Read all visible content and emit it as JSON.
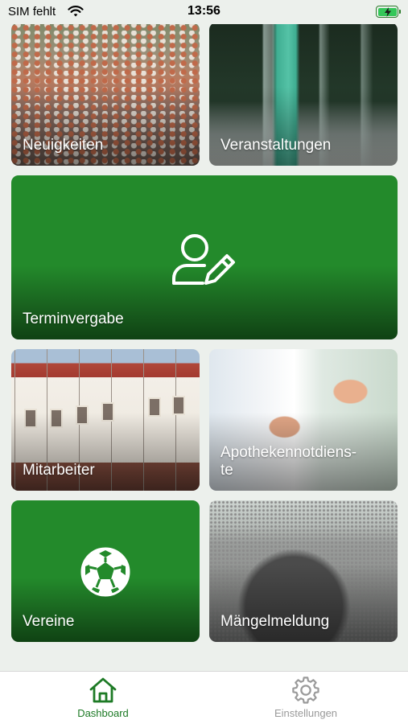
{
  "status_bar": {
    "carrier": "SIM fehlt",
    "time": "13:56",
    "wifi_icon": "wifi-icon",
    "battery_icon": "battery-charging-icon"
  },
  "tiles": {
    "news": {
      "label": "Neuigkeiten"
    },
    "events": {
      "label": "Veranstaltungen"
    },
    "appointment": {
      "label": "Terminvergabe",
      "icon": "user-edit-icon"
    },
    "staff": {
      "label": "Mitarbeiter"
    },
    "pharmacy": {
      "label": "Apothekennotdiens-\nte"
    },
    "clubs": {
      "label": "Vereine",
      "icon": "football-icon"
    },
    "defects": {
      "label": "Mängelmeldung"
    }
  },
  "tabbar": {
    "dashboard": {
      "label": "Dashboard",
      "icon": "home-icon",
      "active": true
    },
    "settings": {
      "label": "Einstellungen",
      "icon": "gear-icon",
      "active": false
    }
  },
  "colors": {
    "accent": "#1d7a25",
    "tile_green": "#238a2b",
    "inactive": "#9a9a9a",
    "background": "#ecf0ec"
  }
}
